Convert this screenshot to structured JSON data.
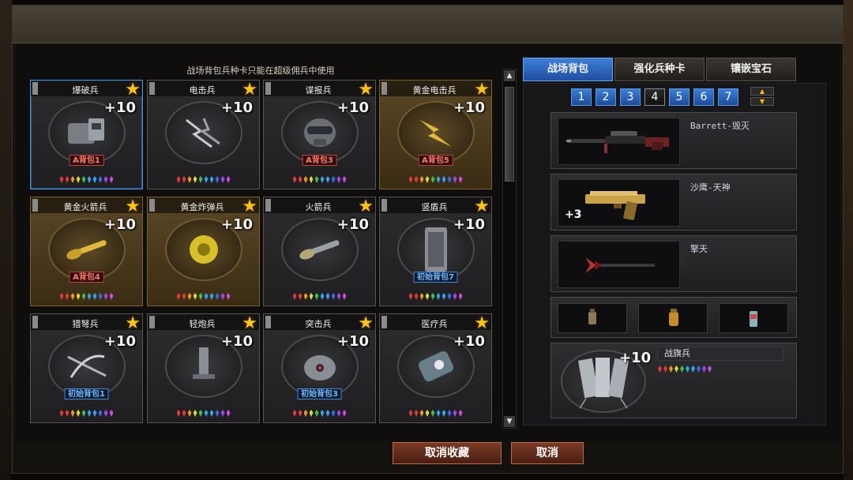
{
  "hint": "战场背包兵种卡只能在超级佣兵中使用",
  "cards": [
    {
      "name": "爆破兵",
      "level": "+10",
      "tag": "A背包1",
      "tag_color": "red",
      "gold": false,
      "selected": true,
      "art": "bomb-kit-icon"
    },
    {
      "name": "电击兵",
      "level": "+10",
      "tag": "",
      "tag_color": "",
      "gold": false,
      "selected": false,
      "art": "lightning-icon"
    },
    {
      "name": "谍报兵",
      "level": "+10",
      "tag": "A背包3",
      "tag_color": "red",
      "gold": false,
      "selected": false,
      "art": "mask-icon"
    },
    {
      "name": "黄金电击兵",
      "level": "+10",
      "tag": "A背包5",
      "tag_color": "red",
      "gold": true,
      "selected": false,
      "art": "golden-lightning-icon"
    },
    {
      "name": "黄金火箭兵",
      "level": "+10",
      "tag": "A背包4",
      "tag_color": "red",
      "gold": true,
      "selected": false,
      "art": "golden-rocket-icon"
    },
    {
      "name": "黄金炸弹兵",
      "level": "+10",
      "tag": "",
      "tag_color": "",
      "gold": true,
      "selected": false,
      "art": "golden-bomb-icon"
    },
    {
      "name": "火箭兵",
      "level": "+10",
      "tag": "",
      "tag_color": "",
      "gold": false,
      "selected": false,
      "art": "rocket-icon"
    },
    {
      "name": "竖盾兵",
      "level": "+10",
      "tag": "初始背包7",
      "tag_color": "blue",
      "gold": false,
      "selected": false,
      "art": "shield-icon"
    },
    {
      "name": "猎弩兵",
      "level": "+10",
      "tag": "初始背包1",
      "tag_color": "blue",
      "gold": false,
      "selected": false,
      "art": "crossbow-icon"
    },
    {
      "name": "轻炮兵",
      "level": "+10",
      "tag": "",
      "tag_color": "",
      "gold": false,
      "selected": false,
      "art": "mortar-icon"
    },
    {
      "name": "突击兵",
      "level": "+10",
      "tag": "初始背包3",
      "tag_color": "blue",
      "gold": false,
      "selected": false,
      "art": "helmet-icon"
    },
    {
      "name": "医疗兵",
      "level": "+10",
      "tag": "",
      "tag_color": "",
      "gold": false,
      "selected": false,
      "art": "medkit-icon"
    }
  ],
  "gem_colors": [
    "#e23a3a",
    "#e23a3a",
    "#e89a2a",
    "#e6d23a",
    "#3fbf4f",
    "#3aa0e8",
    "#3aa0e8",
    "#3a6ae8",
    "#9a4ae8",
    "#d04ae0"
  ],
  "tabs": [
    "战场背包",
    "强化兵种卡",
    "镶嵌宝石"
  ],
  "pages": [
    "1",
    "2",
    "3",
    "4",
    "5",
    "6",
    "7"
  ],
  "active_page": "4",
  "loadout": {
    "primary": "Barrett-毁灭",
    "secondary": "沙鹰-天神",
    "secondary_level": "+3",
    "melee": "擎天",
    "role_name": "战旗兵",
    "role_level": "+10"
  },
  "buttons": {
    "unfavorite": "取消收藏",
    "cancel": "取消"
  }
}
